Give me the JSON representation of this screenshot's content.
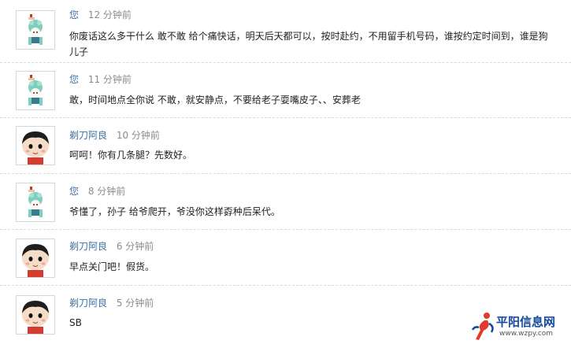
{
  "comments": [
    {
      "author": "您",
      "time": "12 分钟前",
      "avatar": "opera-mask-avatar",
      "text": "你废话这么多干什么  敢不敢  给个痛快话，明天后天都可以，按时赴约，不用留手机号码，谁按约定时间到，谁是狗儿子"
    },
    {
      "author": "您",
      "time": "11 分钟前",
      "avatar": "opera-mask-avatar",
      "text": "敢，时间地点全你说   不敢，就安静点，不要给老子耍嘴皮子、、安葬老"
    },
    {
      "author": "剃刀阿良",
      "time": "10 分钟前",
      "avatar": "cartoon-boy-avatar",
      "text": "呵呵！你有几条腿？先数好。"
    },
    {
      "author": "您",
      "time": "8 分钟前",
      "avatar": "opera-mask-avatar",
      "text": "爷懂了，孙子  给爷爬开，爷没你这样孬种后呆代。"
    },
    {
      "author": "剃刀阿良",
      "time": "6 分钟前",
      "avatar": "cartoon-boy-avatar",
      "text": "早点关门吧！假货。"
    },
    {
      "author": "剃刀阿良",
      "time": "5 分钟前",
      "avatar": "cartoon-boy-avatar",
      "text": "SB"
    }
  ],
  "watermark": {
    "title": "平阳信息网",
    "url": "www.wzpy.com"
  },
  "colors": {
    "author": "#3b6fa8",
    "time": "#8c8c8c",
    "text": "#222222",
    "divider": "#d9d9d9",
    "logo": "#16499c",
    "logo_red": "#e23b2e"
  }
}
